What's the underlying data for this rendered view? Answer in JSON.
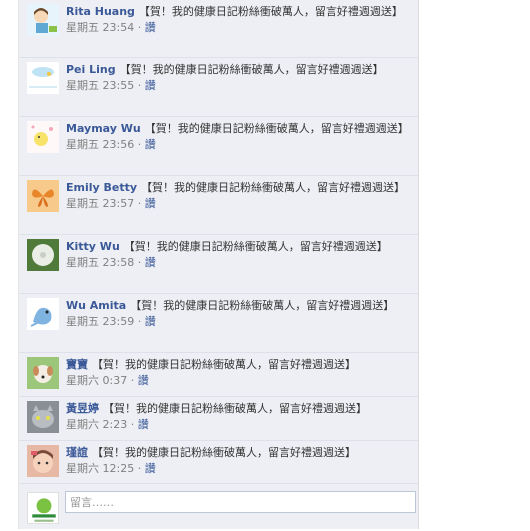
{
  "comments": [
    {
      "author": "Rita Huang",
      "text": "【賀！我的健康日記粉絲衝破萬人，留言好禮週週送】",
      "time": "星期五 23:54",
      "like": "讚",
      "avatar": "cartoon-girl-avatar"
    },
    {
      "author": "Pei Ling",
      "text": "【賀！我的健康日記粉絲衝破萬人，留言好禮週週送】",
      "time": "星期五 23:55",
      "like": "讚",
      "avatar": "sky-cloud-avatar"
    },
    {
      "author": "Maymay Wu",
      "text": "【賀！我的健康日記粉絲衝破萬人，留言好禮週週送】",
      "time": "星期五 23:56",
      "like": "讚",
      "avatar": "chick-cartoon-avatar"
    },
    {
      "author": "Emily Betty",
      "text": "【賀！我的健康日記粉絲衝破萬人，留言好禮週週送】",
      "time": "星期五 23:57",
      "like": "讚",
      "avatar": "butterfly-avatar"
    },
    {
      "author": "Kitty Wu",
      "text": "【賀！我的健康日記粉絲衝破萬人，留言好禮週週送】",
      "time": "星期五 23:58",
      "like": "讚",
      "avatar": "dandelion-avatar"
    },
    {
      "author": "Wu Amita",
      "text": "【賀！我的健康日記粉絲衝破萬人，留言好禮週週送】",
      "time": "星期五 23:59",
      "like": "讚",
      "avatar": "blue-dragon-avatar"
    },
    {
      "author": "寶寶",
      "text": "【賀！我的健康日記粉絲衝破萬人，留言好禮週週送】",
      "time": "星期六 0:37",
      "like": "讚",
      "avatar": "puppy-avatar"
    },
    {
      "author": "黃昱婷",
      "text": "【賀！我的健康日記粉絲衝破萬人，留言好禮週週送】",
      "time": "星期六 2:23",
      "like": "讚",
      "avatar": "cat-avatar"
    },
    {
      "author": "瑾誼",
      "text": "【賀！我的健康日記粉絲衝破萬人，留言好禮週週送】",
      "time": "星期六 12:25",
      "like": "讚",
      "avatar": "baby-avatar"
    }
  ],
  "meta_separator": " · ",
  "composer": {
    "placeholder": "留言……",
    "avatar": "page-logo-avatar"
  },
  "colors": {
    "link": "#3b5998",
    "panel_bg": "#edeff4",
    "meta": "#808080",
    "input_border": "#bdc7d8"
  }
}
